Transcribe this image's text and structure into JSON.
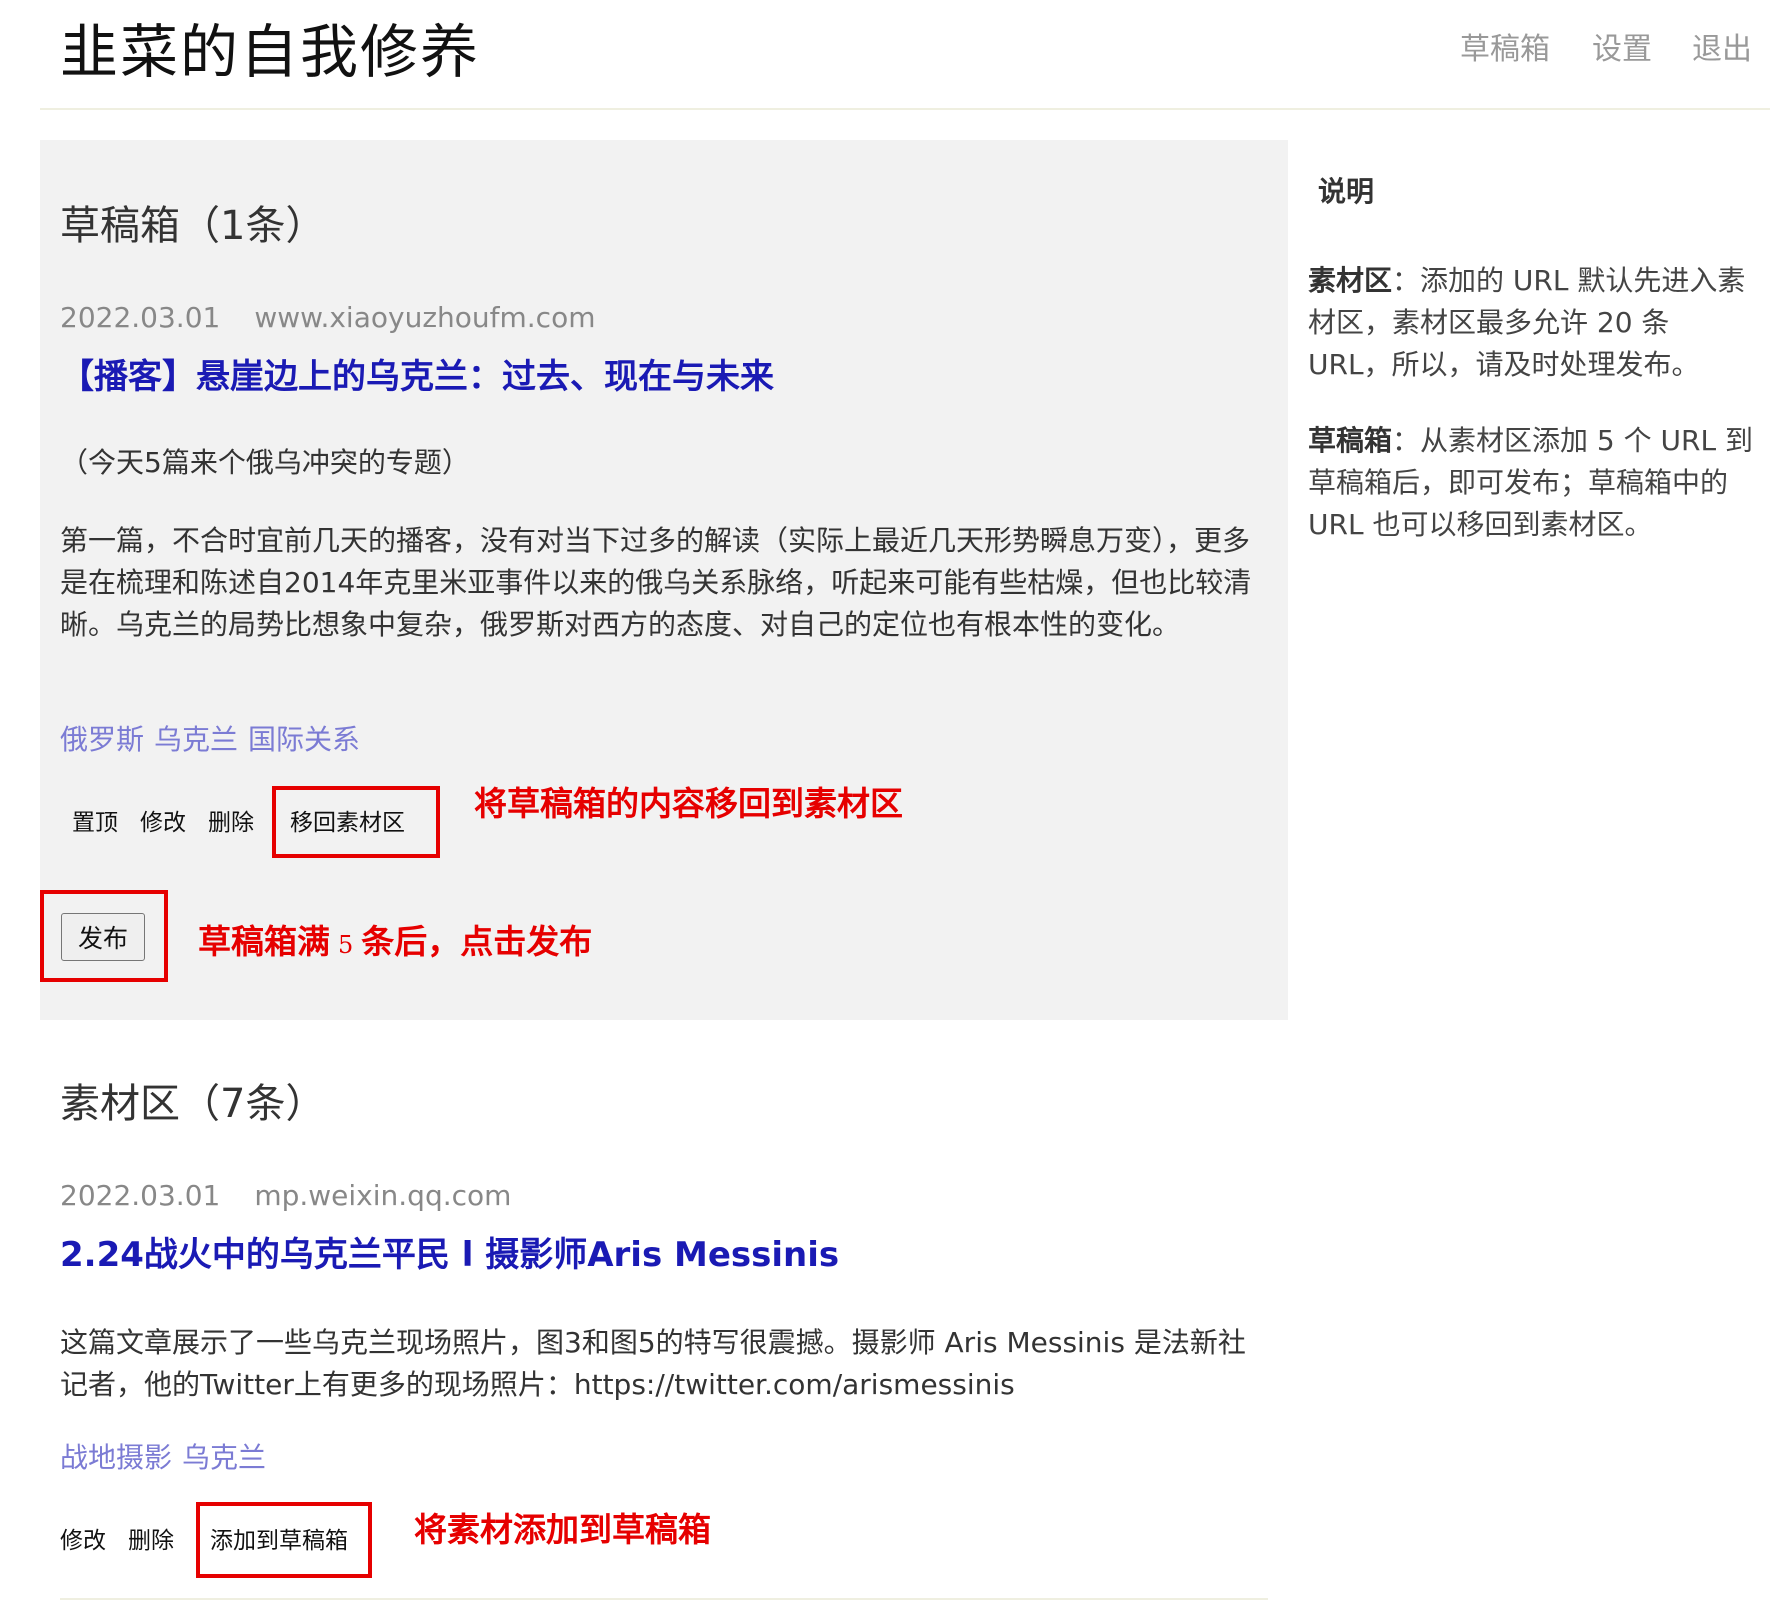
{
  "header": {
    "site_title": "韭菜的自我修养",
    "nav": [
      "草稿箱",
      "设置",
      "退出"
    ]
  },
  "drafts": {
    "heading": "草稿箱（1条）",
    "item": {
      "date": "2022.03.01",
      "domain": "www.xiaoyuzhoufm.com",
      "title": "【播客】悬崖边上的乌克兰：过去、现在与未来",
      "intro": "（今天5篇来个俄乌冲突的专题）",
      "description": "第一篇，不合时宜前几天的播客，没有对当下过多的解读（实际上最近几天形势瞬息万变），更多是在梳理和陈述自2014年克里米亚事件以来的俄乌关系脉络，听起来可能有些枯燥，但也比较清晰。乌克兰的局势比想象中复杂，俄罗斯对西方的态度、对自己的定位也有根本性的变化。",
      "tags": [
        "俄罗斯",
        "乌克兰",
        "国际关系"
      ],
      "actions": {
        "pin": "置顶",
        "edit": "修改",
        "delete": "删除",
        "move_back": "移回素材区"
      }
    },
    "publish_label": "发布",
    "annotations": {
      "move_back": "将草稿箱的内容移回到素材区",
      "publish_prefix": "草稿箱满",
      "publish_number": "5",
      "publish_suffix": "条后，点击发布"
    }
  },
  "materials": {
    "heading": "素材区（7条）",
    "item": {
      "date": "2022.03.01",
      "domain": "mp.weixin.qq.com",
      "title": "2.24战火中的乌克兰平民 l 摄影师Aris Messinis",
      "description": "这篇文章展示了一些乌克兰现场照片，图3和图5的特写很震撼。摄影师 Aris Messinis 是法新社记者，他的Twitter上有更多的现场照片：https://twitter.com/arismessinis",
      "tags": [
        "战地摄影",
        "乌克兰"
      ],
      "actions": {
        "edit": "修改",
        "delete": "删除",
        "add_to_drafts": "添加到草稿箱"
      }
    },
    "annotations": {
      "add_to_drafts": "将素材添加到草稿箱"
    }
  },
  "sidebar": {
    "heading": "说明",
    "para1_label": "素材区",
    "para1_text": "：添加的 URL 默认先进入素材区，素材区最多允许 20 条 URL，所以，请及时处理发布。",
    "para2_label": "草稿箱",
    "para2_text": "：从素材区添加 5 个 URL 到草稿箱后，即可发布；草稿箱中的 URL 也可以移回到素材区。"
  },
  "colors": {
    "title_link": "#1a1ab4",
    "tag": "#7b7bd4",
    "annotation": "#e60000",
    "panel_bg": "#f2f2f2"
  }
}
